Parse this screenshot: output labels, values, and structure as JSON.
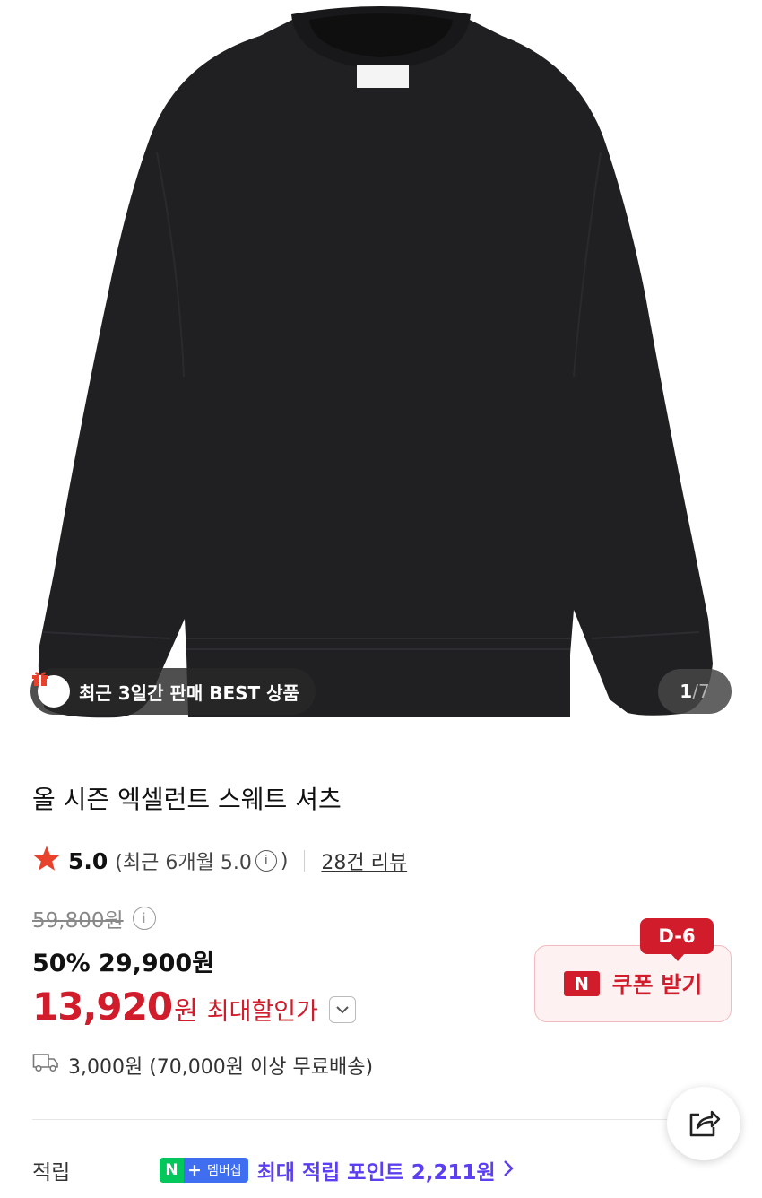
{
  "hero": {
    "best_badge": "최근 3일간 판매 BEST 상품",
    "pager_current": "1",
    "pager_sep": "/",
    "pager_total": "7"
  },
  "product": {
    "title": "올 시즌 엑셀런트 스웨트 셔츠",
    "rating": "5.0",
    "rating_recent": "(최근 6개월 5.0",
    "rating_recent_close": ")",
    "review_link": "28건 리뷰",
    "original_price": "59,800원",
    "sale_line": "50% 29,900원",
    "max_discount_price": "13,920",
    "max_discount_won": "원",
    "max_discount_label": "최대할인가",
    "shipping": "3,000원 (70,000원 이상 무료배송)"
  },
  "coupon": {
    "d_day": "D-6",
    "badge": "N",
    "label": "쿠폰 받기"
  },
  "points": {
    "label": "적립",
    "membership_n": "N",
    "membership_plus": "+",
    "membership_text": "멤버십",
    "text": "최대 적립 포인트 2,211원"
  },
  "colors": {
    "accent_red": "#d11c2c",
    "star": "#e8412c",
    "points_purple": "#5b3ff0",
    "naver_green": "#03c75a"
  },
  "icons": [
    "gift-icon",
    "star-icon",
    "info-icon",
    "chevron-down-icon",
    "truck-icon",
    "share-icon",
    "chevron-right-icon"
  ]
}
